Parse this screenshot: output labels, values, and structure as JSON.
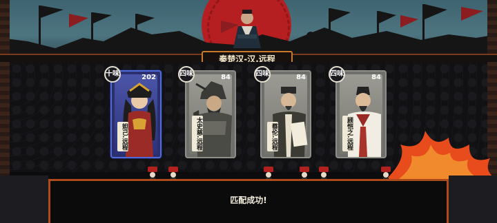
{
  "banner": {
    "title": "秦楚汉-汉.远程"
  },
  "cards": [
    {
      "rank": "十味",
      "power": "202",
      "name": "妲己.远程",
      "frame": "blue"
    },
    {
      "rank": "四味",
      "power": "84",
      "name": "太史慈.远程",
      "frame": "grey"
    },
    {
      "rank": "四味",
      "power": "84",
      "name": "蔡伦.远程",
      "frame": "grey"
    },
    {
      "rank": "四味",
      "power": "84",
      "name": "顾恺之.远程",
      "frame": "grey"
    }
  ],
  "status": {
    "message": "匹配成功!"
  },
  "colors": {
    "accent": "#c97a2c",
    "sun": "#b51f22",
    "card_highlight": "#4f6bd8"
  }
}
